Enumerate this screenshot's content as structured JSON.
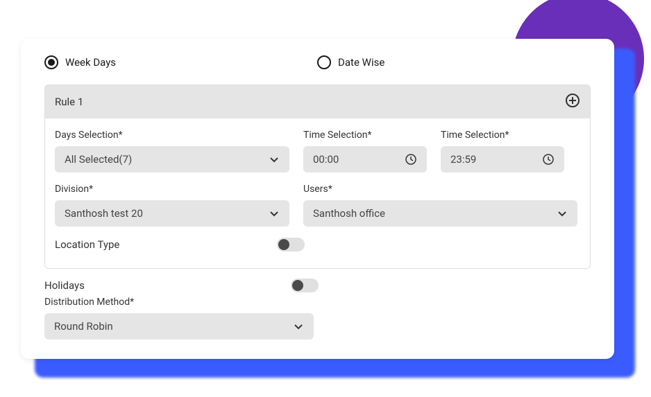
{
  "tabs": {
    "weekdays": "Week Days",
    "datewise": "Date Wise"
  },
  "rule": {
    "title": "Rule 1",
    "daysSelection": {
      "label": "Days Selection*",
      "value": "All Selected(7)"
    },
    "timeStart": {
      "label": "Time Selection*",
      "value": "00:00"
    },
    "timeEnd": {
      "label": "Time Selection*",
      "value": "23:59"
    },
    "division": {
      "label": "Division*",
      "value": "Santhosh test 20"
    },
    "users": {
      "label": "Users*",
      "value": "Santhosh office"
    },
    "locationType": {
      "label": "Location Type"
    }
  },
  "holidays": {
    "label": "Holidays"
  },
  "distribution": {
    "label": "Distribution Method*",
    "value": "Round Robin"
  }
}
